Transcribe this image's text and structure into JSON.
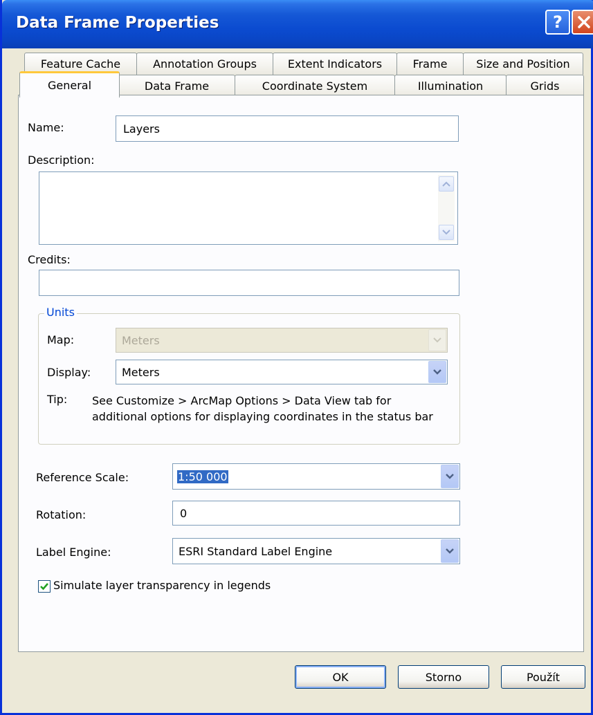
{
  "window": {
    "title": "Data Frame Properties"
  },
  "tabs_row1": [
    "Feature Cache",
    "Annotation Groups",
    "Extent Indicators",
    "Frame",
    "Size and Position"
  ],
  "tabs_row2": [
    "General",
    "Data Frame",
    "Coordinate System",
    "Illumination",
    "Grids"
  ],
  "active_tab": "General",
  "general": {
    "name_label": "Name:",
    "name_value": "Layers",
    "description_label": "Description:",
    "description_value": "",
    "credits_label": "Credits:",
    "credits_value": "",
    "units": {
      "caption": "Units",
      "map_label": "Map:",
      "map_value": "Meters",
      "display_label": "Display:",
      "display_value": "Meters",
      "tip_label": "Tip:",
      "tip_text": "See Customize > ArcMap Options > Data View tab for additional options for displaying coordinates in the status bar"
    },
    "reference_scale_label": "Reference Scale:",
    "reference_scale_value": "1:50 000",
    "rotation_label": "Rotation:",
    "rotation_value": "0",
    "label_engine_label": "Label Engine:",
    "label_engine_value": "ESRI Standard Label Engine",
    "simulate_transparency_label": "Simulate layer transparency in legends",
    "simulate_transparency_checked": true
  },
  "buttons": {
    "ok": "OK",
    "cancel": "Storno",
    "apply": "Použít"
  },
  "colors": {
    "title_bar": "#0b4bd0",
    "active_tab_accent": "#ffc83c",
    "group_caption": "#0046d5",
    "check": "#21a121"
  }
}
